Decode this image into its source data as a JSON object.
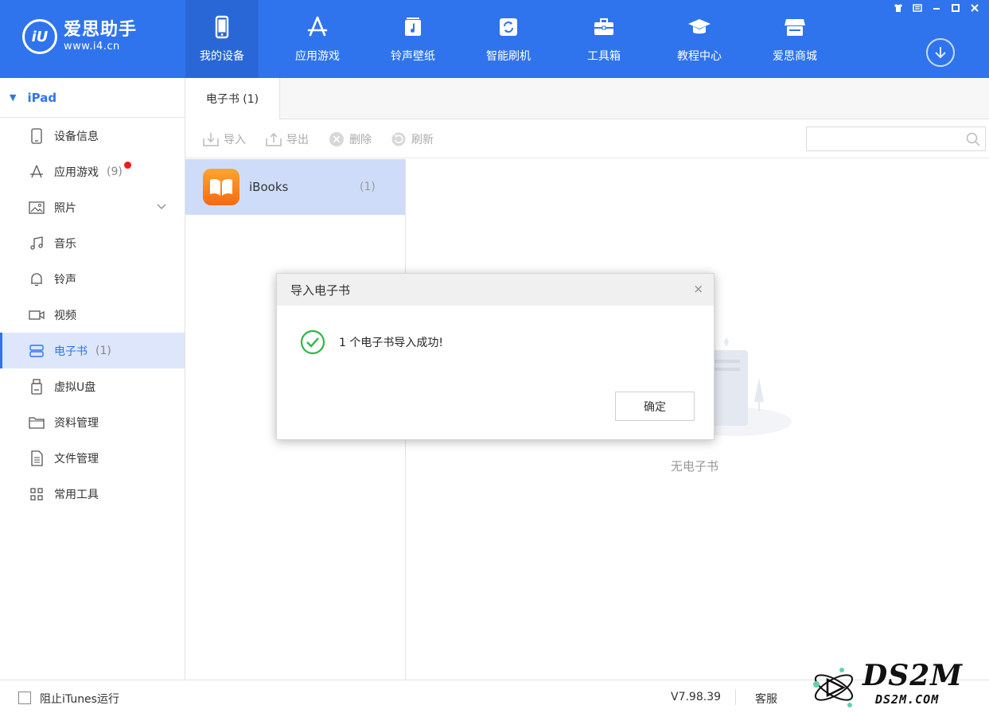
{
  "app": {
    "logo_name": "爱思助手",
    "logo_url": "www.i4.cn",
    "logo_mark": "iU"
  },
  "nav": [
    {
      "label": "我的设备",
      "icon": "phone-icon",
      "active": true
    },
    {
      "label": "应用游戏",
      "icon": "app-store-icon"
    },
    {
      "label": "铃声壁纸",
      "icon": "ringtone-icon"
    },
    {
      "label": "智能刷机",
      "icon": "flash-icon"
    },
    {
      "label": "工具箱",
      "icon": "toolbox-icon"
    },
    {
      "label": "教程中心",
      "icon": "graduation-cap-icon"
    },
    {
      "label": "爱思商城",
      "icon": "store-icon"
    }
  ],
  "sidebar": {
    "device": "iPad",
    "items": [
      {
        "label": "设备信息",
        "icon": "tablet-icon"
      },
      {
        "label": "应用游戏",
        "count": "(9)",
        "icon": "app-store-icon",
        "badge": true
      },
      {
        "label": "照片",
        "icon": "photo-icon",
        "expandable": true
      },
      {
        "label": "音乐",
        "icon": "music-icon"
      },
      {
        "label": "铃声",
        "icon": "bell-icon"
      },
      {
        "label": "视频",
        "icon": "video-icon"
      },
      {
        "label": "电子书",
        "count": "(1)",
        "icon": "book-icon",
        "active": true
      },
      {
        "label": "虚拟U盘",
        "icon": "usb-icon"
      },
      {
        "label": "资料管理",
        "icon": "folder-icon"
      },
      {
        "label": "文件管理",
        "icon": "file-icon"
      },
      {
        "label": "常用工具",
        "icon": "grid-icon"
      }
    ]
  },
  "tab": {
    "label": "电子书 (1)"
  },
  "toolbar": {
    "import": "导入",
    "export": "导出",
    "delete": "删除",
    "refresh": "刷新",
    "search_placeholder": ""
  },
  "list": [
    {
      "name": "iBooks",
      "count": "(1)",
      "icon": "ibooks-icon"
    }
  ],
  "empty": {
    "text": "无电子书"
  },
  "dialog": {
    "title": "导入电子书",
    "close": "×",
    "message": "1 个电子书导入成功!",
    "ok": "确定"
  },
  "status": {
    "itunes_label": "阻止iTunes运行",
    "version": "V7.98.39",
    "service": "客服"
  },
  "watermark": {
    "main": "DS2M",
    "sub": "DS2M.COM"
  },
  "colors": {
    "brand": "#2f74ec",
    "success": "#2fb54a",
    "badge": "#f21b1b"
  }
}
